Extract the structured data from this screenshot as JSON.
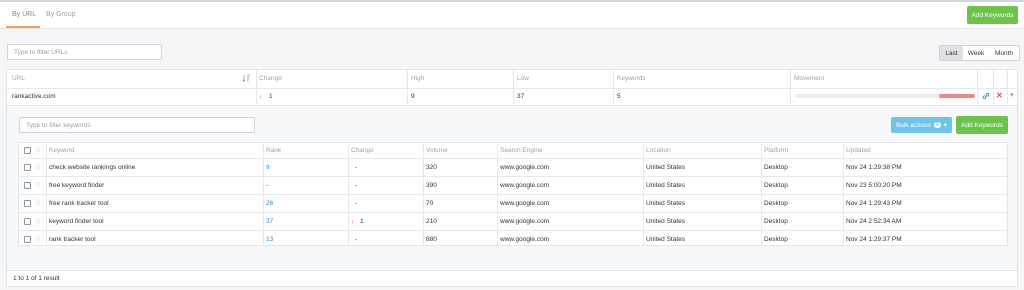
{
  "tabs": [
    {
      "label": "By URL",
      "active": true
    },
    {
      "label": "By Group",
      "active": false
    }
  ],
  "add_keywords_label": "Add Keywords",
  "url_filter": {
    "placeholder": "Type to filter URLs",
    "value": ""
  },
  "period": {
    "options": [
      "Last",
      "Week",
      "Month"
    ],
    "selected": "Last"
  },
  "url_table": {
    "headers": {
      "url": "URL",
      "change": "Change",
      "high": "High",
      "low": "Low",
      "keywords": "Keywords",
      "movement": "Movement"
    },
    "row": {
      "url": "rankactive.com",
      "change": "1",
      "change_direction": "down",
      "high": "9",
      "low": "37",
      "keywords": "5",
      "movement_fraction": 0.2
    }
  },
  "keyword_filter": {
    "placeholder": "Type to filter keywords",
    "value": ""
  },
  "bulk_actions": {
    "label": "Bulk actions",
    "count": "0"
  },
  "keyword_table": {
    "headers": {
      "keyword": "Keyword",
      "rank": "Rank",
      "change": "Change",
      "volume": "Volume",
      "engine": "Search Engine",
      "location": "Location",
      "platform": "Platform",
      "updated": "Updated"
    },
    "rows": [
      {
        "keyword": "check website rankings online",
        "rank": "9",
        "change": "-",
        "volume": "320",
        "engine": "www.google.com",
        "location": "United States",
        "platform": "Desktop",
        "updated": "Nov 24 1:29:38 PM"
      },
      {
        "keyword": "free keyword finder",
        "rank": "-",
        "change": "-",
        "volume": "390",
        "engine": "www.google.com",
        "location": "United States",
        "platform": "Desktop",
        "updated": "Nov 23 5:00:20 PM"
      },
      {
        "keyword": "free rank tracker tool",
        "rank": "26",
        "change": "-",
        "volume": "70",
        "engine": "www.google.com",
        "location": "United States",
        "platform": "Desktop",
        "updated": "Nov 24 1:29:43 PM"
      },
      {
        "keyword": "keyword finder tool",
        "rank": "37",
        "change": "1",
        "change_direction": "down",
        "volume": "210",
        "engine": "www.google.com",
        "location": "United States",
        "platform": "Desktop",
        "updated": "Nov 24 2:52:34 AM"
      },
      {
        "keyword": "rank tracker tool",
        "rank": "13",
        "change": "-",
        "volume": "880",
        "engine": "www.google.com",
        "location": "United States",
        "platform": "Desktop",
        "updated": "Nov 24 1:29:37 PM"
      }
    ]
  },
  "pagination": "1 to 1 of 1 result",
  "icons": {
    "sort": "sort-icon",
    "link": "link-icon",
    "delete": "close-icon",
    "expand": "chevron-down-icon",
    "star": "star-icon",
    "arrow_down": "arrow-down-icon"
  },
  "colors": {
    "green": "#6cc24a",
    "blue_button": "#6fc3e8",
    "link": "#2a8fc9",
    "down": "#e8504a",
    "tab_underline": "#f0a050"
  }
}
